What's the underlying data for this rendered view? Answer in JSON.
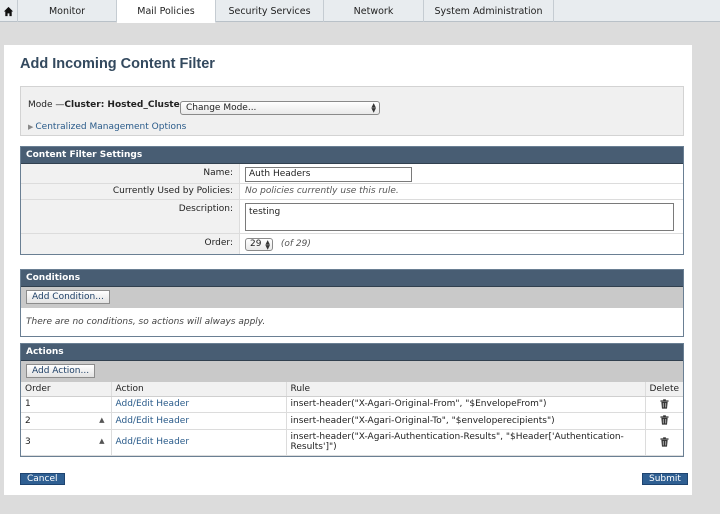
{
  "nav": {
    "tabs": [
      {
        "label": "Monitor"
      },
      {
        "label": "Mail Policies"
      },
      {
        "label": "Security Services"
      },
      {
        "label": "Network"
      },
      {
        "label": "System Administration"
      }
    ]
  },
  "page": {
    "title": "Add Incoming Content Filter"
  },
  "mode": {
    "label_prefix": "Mode —",
    "cluster": "Cluster: Hosted_Cluster",
    "select_value": "Change Mode...",
    "central_mgmt": "Centralized Management Options"
  },
  "settings": {
    "header": "Content Filter Settings",
    "name_label": "Name:",
    "name_value": "Auth Headers",
    "used_label": "Currently Used by Policies:",
    "used_value": "No policies currently use this rule.",
    "desc_label": "Description:",
    "desc_value": "testing",
    "order_label": "Order:",
    "order_value": "29",
    "order_total": "(of 29)"
  },
  "conditions": {
    "header": "Conditions",
    "add_button": "Add Condition...",
    "message": "There are no conditions, so actions will always apply."
  },
  "actions": {
    "header": "Actions",
    "add_button": "Add Action...",
    "columns": {
      "order": "Order",
      "action": "Action",
      "rule": "Rule",
      "delete": "Delete"
    },
    "rows": [
      {
        "order": "1",
        "action": "Add/Edit Header",
        "rule": "insert-header(\"X-Agari-Original-From\", \"$EnvelopeFrom\")"
      },
      {
        "order": "2",
        "action": "Add/Edit Header",
        "rule": "insert-header(\"X-Agari-Original-To\", \"$enveloperecipients\")"
      },
      {
        "order": "3",
        "action": "Add/Edit Header",
        "rule": "insert-header(\"X-Agari-Authentication-Results\", \"$Header['Authentication-Results']\")"
      }
    ]
  },
  "footer": {
    "cancel": "Cancel",
    "submit": "Submit"
  }
}
